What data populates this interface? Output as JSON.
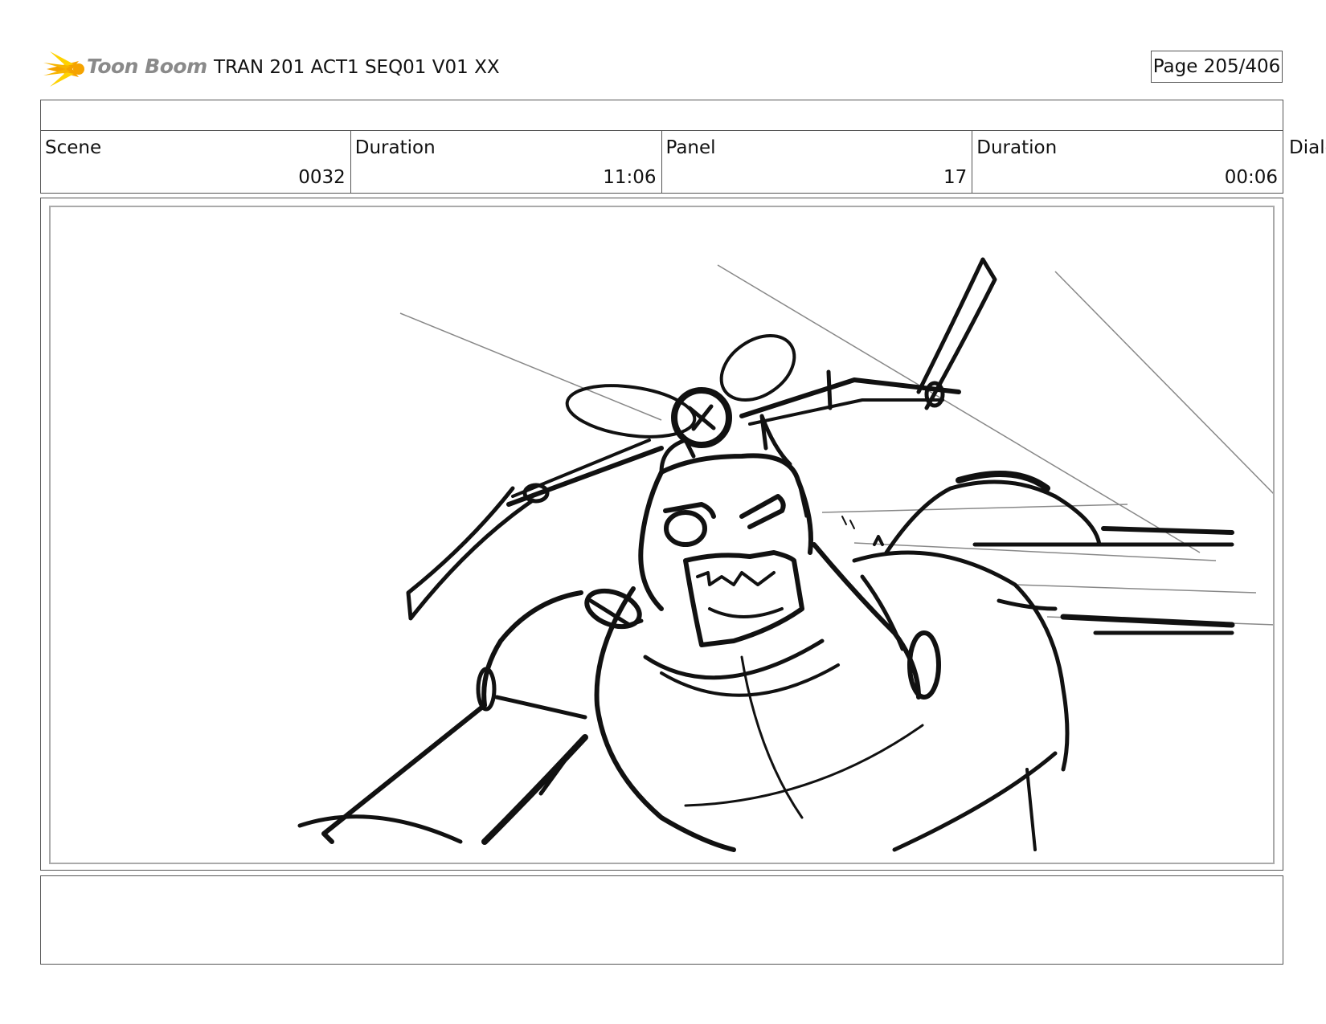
{
  "header": {
    "logo_text": "Toon Boom",
    "title": "TRAN 201 ACT1 SEQ01 V01 XX",
    "page_label": "Page 205/406"
  },
  "info": {
    "scene_label": "Scene",
    "scene_value": "0032",
    "scene_duration_label": "Duration",
    "scene_duration_value": "11:06",
    "panel_label": "Panel",
    "panel_value": "17",
    "panel_duration_label": "Duration",
    "panel_duration_value": "00:06",
    "dialog_label": "Dialo"
  },
  "colors": {
    "logo_orange": "#f5a300",
    "logo_yellow": "#ffd200",
    "border": "#555555",
    "sketch": "#111111"
  }
}
